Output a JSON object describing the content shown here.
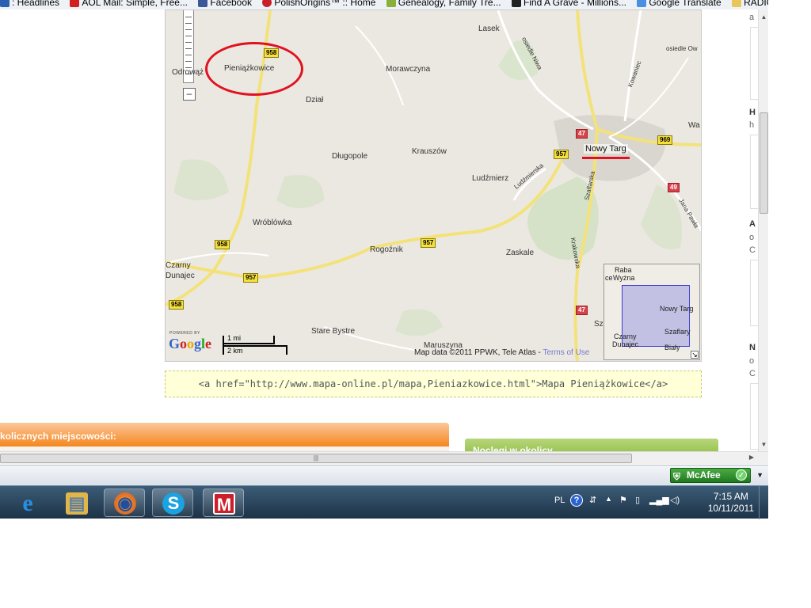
{
  "bookmarks": [
    {
      "label": ": Headlines",
      "icon": "news-icon",
      "color": "#2b5fb0"
    },
    {
      "label": "AOL Mail: Simple, Free...",
      "icon": "aol-icon",
      "color": "#d02020"
    },
    {
      "label": "Facebook",
      "icon": "facebook-icon",
      "color": "#3b5998"
    },
    {
      "label": "PolishOrigins™ :: Home",
      "icon": "polishorigins-icon",
      "color": "#c8202a"
    },
    {
      "label": "Genealogy, Family Tre...",
      "icon": "genealogy-icon",
      "color": "#8ab03a"
    },
    {
      "label": "Find A Grave - Millions...",
      "icon": "findagrave-icon",
      "color": "#222222"
    },
    {
      "label": "Google Translate",
      "icon": "translate-icon",
      "color": "#4a90e2"
    },
    {
      "label": "RADIO",
      "icon": "folder-icon",
      "color": "#e8c65a"
    }
  ],
  "map": {
    "towns": {
      "lasek": "Lasek",
      "osiedle_niwa": "osiedle Niwa",
      "osiedle_ow": "osiedle Ow",
      "kowaniec": "Kowaniec",
      "odrowaz": "Odrowąż",
      "pieniazkowice": "Pieniążkowice",
      "morawczyna": "Morawczyna",
      "dzial": "Dział",
      "wa": "Wa",
      "nowy_targ": "Nowy Targ",
      "dlugopole": "Długopole",
      "krauszow": "Krauszów",
      "ludzmierz": "Ludźmierz",
      "ludzmierska": "Ludźmierska",
      "szaflarska": "Szaflarska",
      "jana_pawla": "Jana Pawła",
      "wroblowka": "Wróblówka",
      "rogoznik": "Rogoźnik",
      "zaskale": "Zaskale",
      "krakowska": "Krakowska",
      "czarny_dunajec": "Czarny Dunajec",
      "stare_bystre": "Stare Bystre",
      "maruszyna": "Maruszyna",
      "sz": "Sz"
    },
    "shields": {
      "s958_top": "958",
      "s47_a": "47",
      "s957_a": "957",
      "s969": "969",
      "s49": "49",
      "s958_mid": "958",
      "s957_b": "957",
      "s957_c": "957",
      "s958_low": "958",
      "s47_b": "47"
    },
    "zoom_out_label": "–",
    "powered_by": "POWERED BY",
    "google_letters": [
      "G",
      "o",
      "o",
      "g",
      "l",
      "e"
    ],
    "google_colors": [
      "#3366cc",
      "#cc2222",
      "#e8a800",
      "#3366cc",
      "#22aa22",
      "#cc2222"
    ],
    "scale_mi": "1 mi",
    "scale_km": "2 km",
    "attribution": "Map data ©2011 PPWK, Tele Atlas - ",
    "terms": "Terms of Use",
    "overview": {
      "labels": [
        "Raba",
        "Wyżna",
        "Nowy Targ",
        "Szaflary",
        "Czarny",
        "Dunajec",
        "Biały",
        "ce"
      ],
      "toggle": "↘"
    },
    "highlight_color": "#e2111f"
  },
  "embed_code": "<a href=\"http://www.mapa-online.pl/mapa,Pieniazkowice.html\">Mapa Pieniążkowice</a>",
  "nearby_header": "kolicznych miejscowości:",
  "news_header": "Noclegi w okolicy",
  "right_col": {
    "t1": "a",
    "t2": "H",
    "t3": "h",
    "t4": "A",
    "t5": "o",
    "t6": "C",
    "t7": "N",
    "t8": "o",
    "t9": "C"
  },
  "hscroll_grip": "|||",
  "statusbar": {
    "mcafee": "McAfee",
    "mcafee_ok": "✓",
    "menu_arrow": "▼"
  },
  "taskbar": {
    "apps": [
      {
        "name": "internet-explorer",
        "glyph": "e",
        "bg": "#2a8ee0"
      },
      {
        "name": "windows-explorer",
        "glyph": "▤",
        "bg": "#e0b54a"
      },
      {
        "name": "firefox",
        "glyph": "◉",
        "bg": "#e06a1a"
      },
      {
        "name": "skype",
        "glyph": "S",
        "bg": "#1aa3e0"
      },
      {
        "name": "mcafee-app",
        "glyph": "M",
        "bg": "#cc1f2a"
      }
    ],
    "lang": "PL",
    "help": "?",
    "time": "7:15 AM",
    "date": "10/11/2011"
  }
}
